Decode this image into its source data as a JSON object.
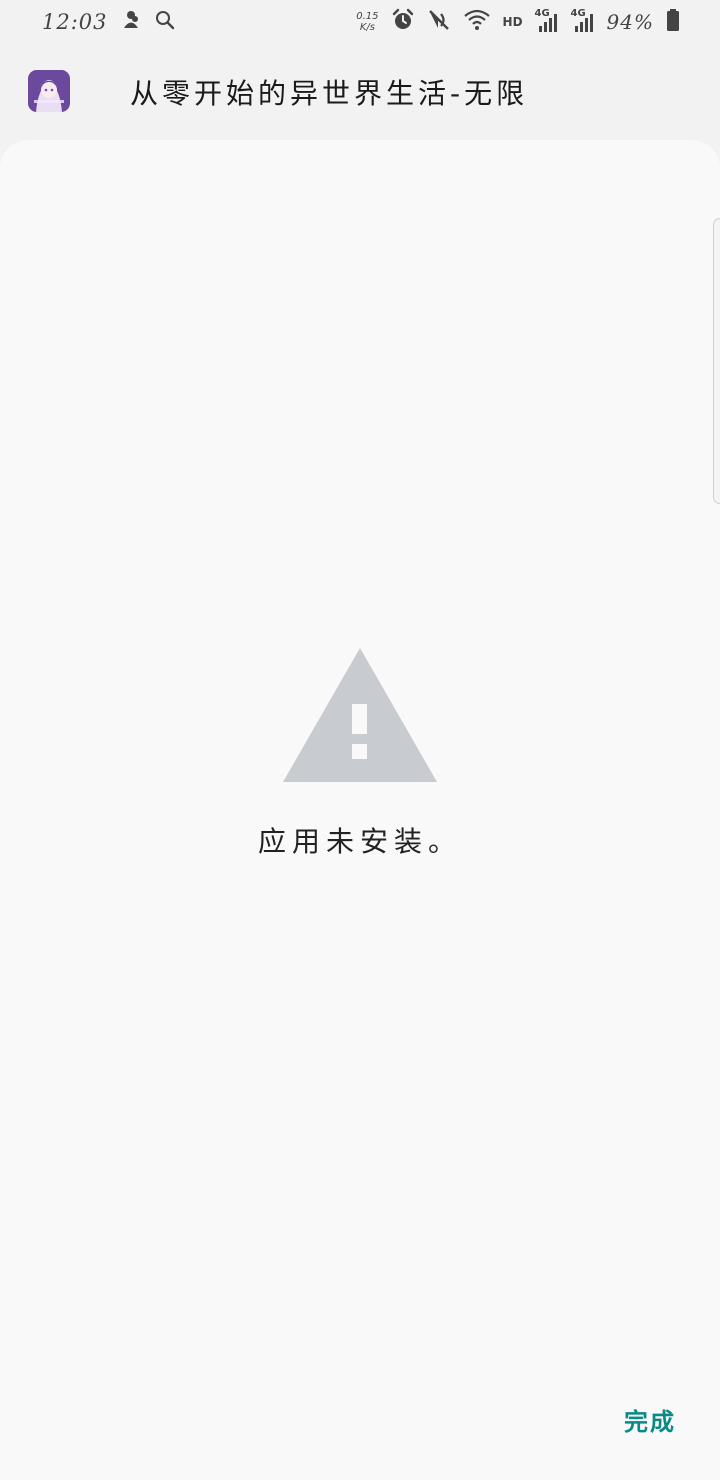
{
  "status_bar": {
    "time": "12:03",
    "net_speed_value": "0.15",
    "net_speed_unit": "K/s",
    "hd_label": "HD",
    "signal1_label": "4G",
    "signal2_label": "4G",
    "battery_percent": "94%",
    "icons": [
      "ghost-icon",
      "search-icon",
      "alarm-icon",
      "mute-icon",
      "wifi-icon",
      "signal-icon",
      "battery-icon"
    ]
  },
  "header": {
    "app_title": "从零开始的异世界生活-无限",
    "app_icon": "app-icon"
  },
  "main": {
    "message": "应用未安装。",
    "warning_icon": "warning-icon"
  },
  "footer": {
    "done_label": "完成"
  },
  "colors": {
    "accent": "#0a8a86",
    "warning_icon": "#c8cbcf",
    "card_background": "#f9f9f9",
    "page_background": "#f2f2f2"
  }
}
